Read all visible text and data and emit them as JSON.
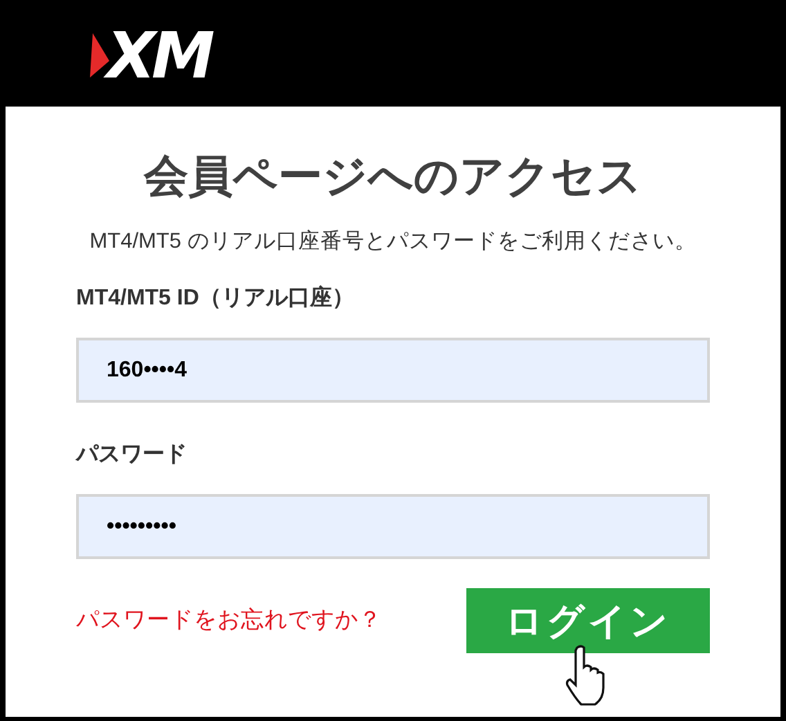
{
  "header": {
    "logo": "XM"
  },
  "title": "会員ページへのアクセス",
  "subtitle": "MT4/MT5 のリアル口座番号とパスワードをご利用ください。",
  "fields": [
    {
      "label": "MT4/MT5 ID（リアル口座）",
      "value": "160••••4"
    },
    {
      "label": "パスワード",
      "value": "•••••••••"
    }
  ],
  "forgot_link": "パスワードをお忘れですか？",
  "login_button": "ログイン"
}
